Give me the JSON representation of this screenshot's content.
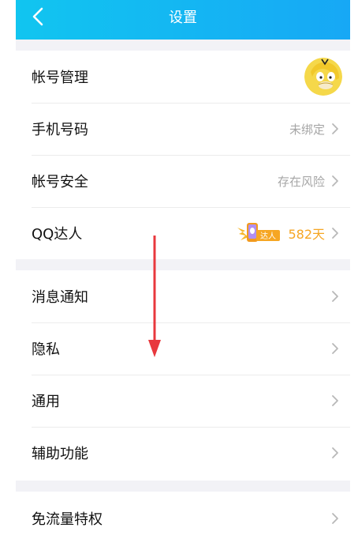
{
  "nav": {
    "title": "设置"
  },
  "groups": {
    "account": {
      "account_manage": {
        "label": "帐号管理"
      },
      "phone": {
        "label": "手机号码",
        "value": "未绑定"
      },
      "security": {
        "label": "帐号安全",
        "value": "存在风险"
      },
      "qq_expert": {
        "label": "QQ达人",
        "badge_text": "达人",
        "days": "582天"
      }
    },
    "general": {
      "notifications": {
        "label": "消息通知"
      },
      "privacy": {
        "label": "隐私"
      },
      "common": {
        "label": "通用"
      },
      "accessibility": {
        "label": "辅助功能"
      }
    },
    "extra": {
      "free_data": {
        "label": "免流量特权"
      }
    }
  },
  "colors": {
    "nav_gradient_start": "#11c5f0",
    "nav_gradient_end": "#17a8f5",
    "annotation_arrow": "#e8383d",
    "badge_orange": "#f6a623"
  },
  "icons": [
    "back-icon",
    "avatar-duck-icon",
    "qq-expert-badge-icon",
    "chevron-right-icon",
    "annotation-arrow-icon"
  ]
}
